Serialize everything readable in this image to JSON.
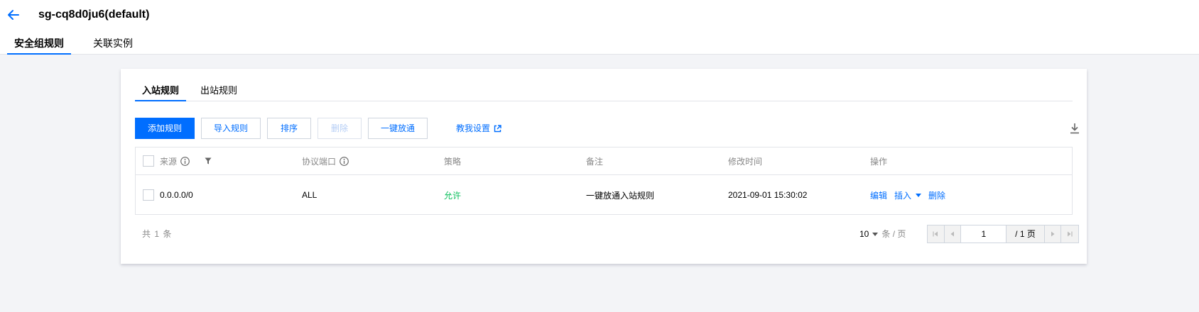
{
  "header": {
    "title": "sg-cq8d0ju6(default)",
    "tabs": [
      {
        "label": "安全组规则",
        "active": true
      },
      {
        "label": "关联实例",
        "active": false
      }
    ]
  },
  "card": {
    "sub_tabs": [
      {
        "label": "入站规则",
        "active": true
      },
      {
        "label": "出站规则",
        "active": false
      }
    ],
    "toolbar": {
      "add_rule": "添加规则",
      "import_rule": "导入规则",
      "sort": "排序",
      "delete": "删除",
      "one_click_open": "一键放通",
      "help_link": "教我设置",
      "download_icon": "download-icon"
    },
    "table": {
      "columns": [
        "来源",
        "协议端口",
        "策略",
        "备注",
        "修改时间",
        "操作"
      ],
      "rows": [
        {
          "source": "0.0.0.0/0",
          "protocol_port": "ALL",
          "policy": "允许",
          "remark": "一键放通入站规则",
          "modified_time": "2021-09-01 15:30:02",
          "actions": [
            "编辑",
            "插入",
            "删除"
          ]
        }
      ]
    },
    "pagination": {
      "total_text": "共 1 条",
      "page_size": "10",
      "per_page_label": "条 / 页",
      "current_page": "1",
      "total_pages": "/ 1 页"
    }
  },
  "colors": {
    "accent": "#006eff",
    "allow": "#0abf5b",
    "muted": "#888888",
    "background": "#f3f4f7"
  }
}
